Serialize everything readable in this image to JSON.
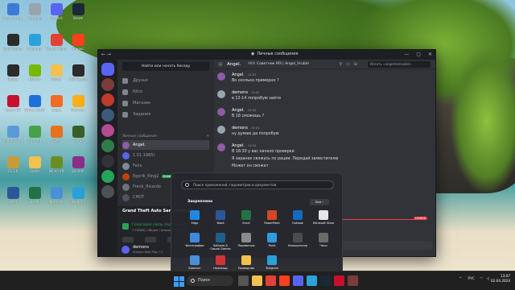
{
  "desktop": {
    "icons": [
      {
        "label": "Этот компьютер",
        "color": "#3a7bd5"
      },
      {
        "label": "Корзина",
        "color": "#9aa4ae"
      },
      {
        "label": "Discord",
        "color": "#5865f2"
      },
      {
        "label": "Steam",
        "color": "#1b2838"
      },
      {
        "label": "Epic Games",
        "color": "#2b2b2b"
      },
      {
        "label": "Telegram",
        "color": "#2aa1da"
      },
      {
        "label": "Google Chrome",
        "color": "#e34133"
      },
      {
        "label": "Яндекс",
        "color": "#fc3f1d"
      },
      {
        "label": "Roblox",
        "color": "#2c2c2c"
      },
      {
        "label": "NVIDIA",
        "color": "#76b900"
      },
      {
        "label": "Folder",
        "color": "#f2c14e"
      },
      {
        "label": "OBS Studio",
        "color": "#2c2c2c"
      },
      {
        "label": "Opera GX",
        "color": "#c8102e"
      },
      {
        "label": "Roblox Studio",
        "color": "#1e6fd9"
      },
      {
        "label": "Avast",
        "color": "#f06b23"
      },
      {
        "label": "Rockstar",
        "color": "#fcaf17"
      },
      {
        "label": "Radmin VPN",
        "color": "#5a9ad8"
      },
      {
        "label": "uTorrent",
        "color": "#45a247"
      },
      {
        "label": "FiveM",
        "color": "#e8711b"
      },
      {
        "label": "GTA SA",
        "color": "#3a5f2a"
      },
      {
        "label": "CS 1.6",
        "color": "#c79b3a"
      },
      {
        "label": "Folder",
        "color": "#f2c14e"
      },
      {
        "label": "Minecraft",
        "color": "#6b8e23"
      },
      {
        "label": "WinRAR",
        "color": "#8b2f8b"
      },
      {
        "label": "Word",
        "color": "#2b579a"
      },
      {
        "label": "Excel",
        "color": "#217346"
      },
      {
        "label": "Notepad",
        "color": "#4a90d9"
      },
      {
        "label": "Telegram",
        "color": "#2aa1da"
      }
    ]
  },
  "discord": {
    "title": "Личные сообщения",
    "nav_arrows": "← →",
    "window_controls": [
      "—",
      "▢",
      "✕"
    ],
    "find_conversation": "Найти или начать беседу",
    "nav": [
      {
        "label": "Друзья",
        "icon": "friends-icon"
      },
      {
        "label": "Nitro",
        "icon": "nitro-icon"
      },
      {
        "label": "Магазин",
        "icon": "shop-icon"
      },
      {
        "label": "Задания",
        "icon": "quests-icon"
      }
    ],
    "dm_header": "Личные сообщения",
    "dm_add": "+",
    "dms": [
      {
        "name": "Angel.",
        "color": "#8e5ba6",
        "active": true,
        "badge": ""
      },
      {
        "name": "1.01.1965r",
        "color": "#5865f2",
        "active": false,
        "badge": ""
      },
      {
        "name": "Felix",
        "color": "#7d8b99",
        "active": false,
        "badge": ""
      },
      {
        "name": "Egorik_King2",
        "color": "#c2410c",
        "active": false,
        "badge": "Онлайн"
      },
      {
        "name": "Frenk_Ricardo",
        "color": "#6b7280",
        "active": false,
        "badge": ""
      },
      {
        "name": "CHOT",
        "color": "#4b5563",
        "active": false,
        "badge": ""
      }
    ],
    "guild_colors": [
      "#5865f2",
      "#7a3b3b",
      "#c0392b",
      "#3b5b7a",
      "#b44b8f",
      "#2f7d4b",
      "#313338",
      "#23a55a",
      "#4e5058"
    ],
    "voice": {
      "game": "Grand Theft Auto San Andreas",
      "status": "Голосовая связь подключена",
      "sub": "7 FUNDS | Общее / Arizona | Weekend"
    },
    "user": {
      "name": "demons",
      "status": "Arizona Role Play +1"
    },
    "chat": {
      "name": "Angel.",
      "tag": "AKA",
      "status": "Советник МЗ | Angel_Vrubel",
      "search_placeholder": "Искать «angelmenzubel»",
      "new_tag": "НОВОЕ",
      "messages": [
        {
          "who": "Angel.",
          "time": "15:03",
          "color": "#8e5ba6",
          "lines": [
            "Во сколько примерно ?"
          ]
        },
        {
          "who": "demons",
          "time": "15:03",
          "color": "#9aa4ae",
          "lines": [
            "в 13-14 попробую зайти"
          ]
        },
        {
          "who": "Angel.",
          "time": "15:03",
          "color": "#8e5ba6",
          "lines": [
            "В 18 сможешь ?"
          ]
        },
        {
          "who": "demons",
          "time": "15:03",
          "color": "#9aa4ae",
          "lines": [
            "ну думаю да попробую"
          ]
        },
        {
          "who": "Angel.",
          "time": "15:04",
          "color": "#8e5ba6",
          "lines": [
            "В 18:30 у вас начало проверки",
            "Я заранее свяжусь по рации. Передай заместителю",
            "Может он сможет"
          ]
        }
      ]
    }
  },
  "start_menu": {
    "search_placeholder": "Поиск приложений, параметров и документов",
    "pinned_label": "Закреплено",
    "all_label": "Все  ›",
    "apps": [
      {
        "label": "Edge",
        "color": "#1e88e5"
      },
      {
        "label": "Word",
        "color": "#2b579a"
      },
      {
        "label": "Excel",
        "color": "#217346"
      },
      {
        "label": "PowerPoint",
        "color": "#d24726"
      },
      {
        "label": "Outlook",
        "color": "#0f6cbd"
      },
      {
        "label": "Microsoft Store",
        "color": "#e6e6e6"
      },
      {
        "label": "Фотографии",
        "color": "#3f8ae0"
      },
      {
        "label": "Solitaire & Casual Games",
        "color": "#1f5f8b"
      },
      {
        "label": "Параметры",
        "color": "#8a8a8a"
      },
      {
        "label": "Paint",
        "color": "#2f9be0"
      },
      {
        "label": "Калькулятор",
        "color": "#4c4c4c"
      },
      {
        "label": "Часы",
        "color": "#6b6b6b"
      },
      {
        "label": "Блокнот",
        "color": "#4a90d9"
      },
      {
        "label": "Ножницы",
        "color": "#d13438"
      },
      {
        "label": "Проводник",
        "color": "#f2c14e"
      },
      {
        "label": "Telegram",
        "color": "#2aa1da"
      }
    ]
  },
  "taskbar": {
    "search": "Поиск",
    "icons": [
      {
        "name": "task-view-icon",
        "color": "#555"
      },
      {
        "name": "explorer-icon",
        "color": "#f2c14e"
      },
      {
        "name": "chrome-icon",
        "color": "#e34133"
      },
      {
        "name": "yandex-icon",
        "color": "#fc3f1d"
      },
      {
        "name": "discord-icon",
        "color": "#5865f2"
      },
      {
        "name": "telegram-icon",
        "color": "#2aa1da"
      },
      {
        "name": "steam-icon",
        "color": "#1b2838"
      },
      {
        "name": "opera-icon",
        "color": "#c8102e"
      },
      {
        "name": "app-icon",
        "color": "#7a3b3b"
      }
    ],
    "lang": "РУС",
    "time": "13:07",
    "date": "02.04.2024"
  }
}
